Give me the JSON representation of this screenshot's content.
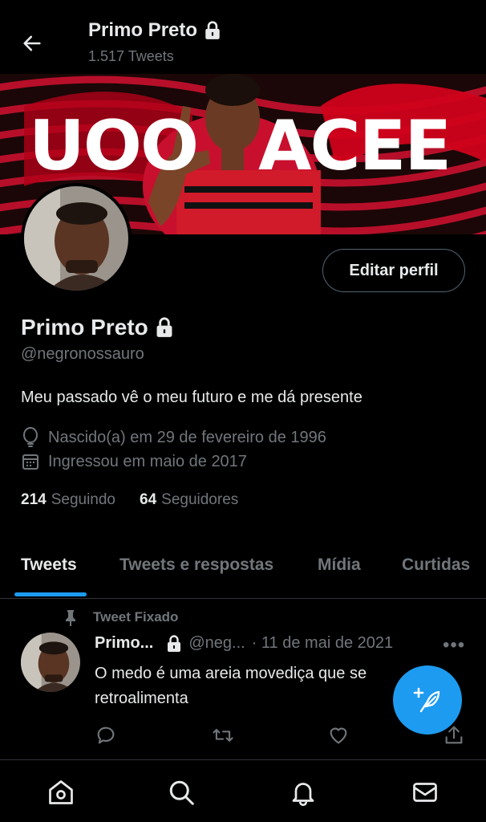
{
  "header": {
    "title": "Primo Preto",
    "tweet_count": "1.517 Tweets"
  },
  "banner": {
    "left_text": "UOO",
    "right_text": "ACEE"
  },
  "profile": {
    "edit_button": "Editar perfil",
    "display_name": "Primo Preto",
    "handle": "@negronossauro",
    "bio": "Meu passado vê o meu futuro e me dá presente",
    "birthday": "Nascido(a) em 29 de fevereiro de 1996",
    "joined": "Ingressou em maio de 2017",
    "following_count": "214",
    "following_label": "Seguindo",
    "followers_count": "64",
    "followers_label": "Seguidores"
  },
  "tabs": [
    {
      "label": "Tweets",
      "active": true
    },
    {
      "label": "Tweets e respostas",
      "active": false
    },
    {
      "label": "Mídia",
      "active": false
    },
    {
      "label": "Curtidas",
      "active": false
    }
  ],
  "pinned_tweet": {
    "pinned_label": "Tweet Fixado",
    "name": "Primo...",
    "handle": "@neg...",
    "date": "· 11 de mai de 2021",
    "more": "•••",
    "text": "O medo é uma areia movediça que se retroalimenta"
  },
  "colors": {
    "background": "#000000",
    "accent": "#1d9bf0",
    "text_primary": "#e7e9ea",
    "text_secondary": "#71767b",
    "border": "#2f3336"
  },
  "icons": {
    "back": "arrow-left-icon",
    "lock": "lock-icon",
    "location": "map-pin-icon",
    "calendar": "calendar-icon",
    "pin": "pin-icon",
    "reply": "reply-icon",
    "retweet": "retweet-icon",
    "like": "heart-icon",
    "share": "share-icon",
    "compose": "compose-feather-icon",
    "home": "home-icon",
    "search": "search-icon",
    "notifications": "bell-icon",
    "messages": "mail-icon"
  }
}
